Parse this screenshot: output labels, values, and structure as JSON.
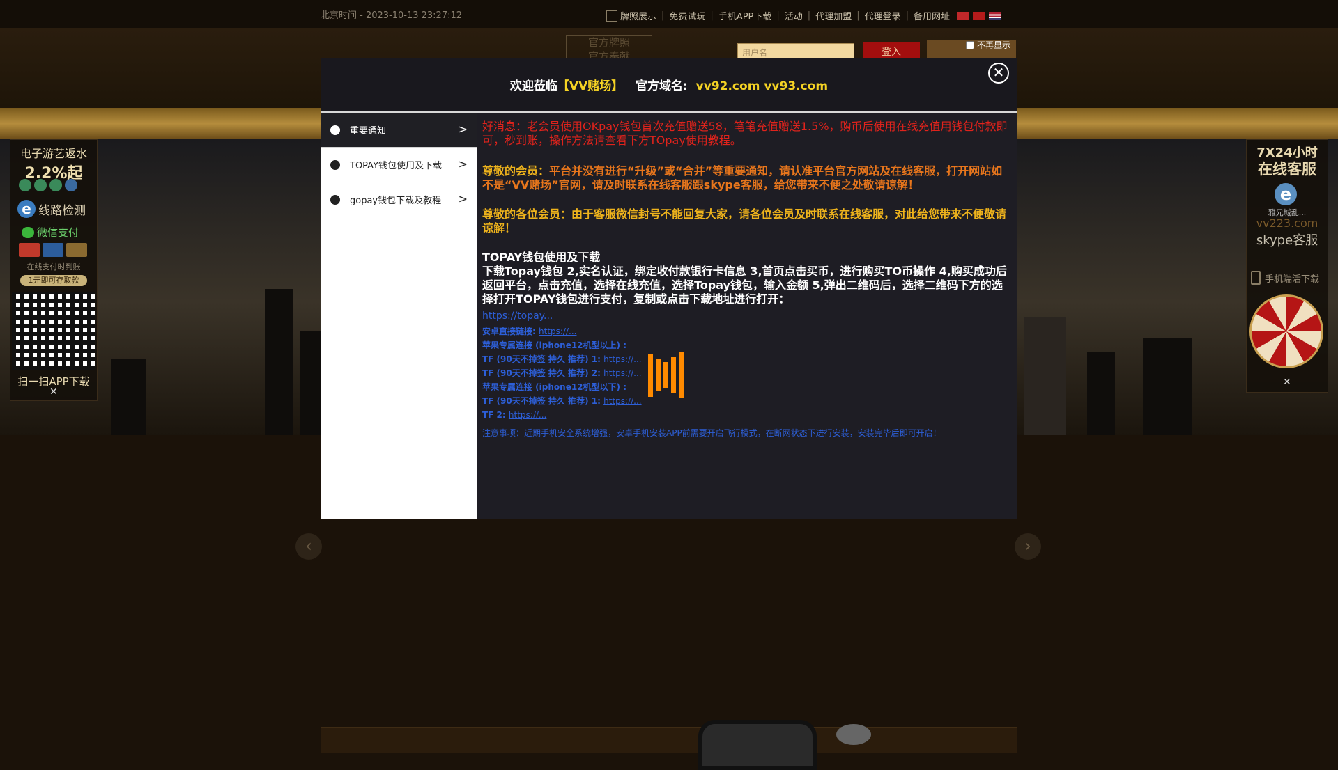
{
  "topbar": {
    "clock": "北京时间 - 2023-10-13 23:27:12",
    "nav": [
      "牌照展示",
      "免费试玩",
      "手机APP下载",
      "活动",
      "代理加盟",
      "代理登录",
      "备用网址"
    ]
  },
  "header": {
    "seal_line1": "官方牌照",
    "seal_line2": "官方奉献",
    "username_placeholder": "用户名",
    "login_label": "登入",
    "no_show_label": "不再显示"
  },
  "left_panel": {
    "title": "电子游艺返水",
    "rate": "2.2%起",
    "line_check": "线路检测",
    "wechat": "微信支付",
    "note": "在线支付时到账",
    "badge": "1元即可存取款",
    "qr_caption": "扫一扫APP下载",
    "close": "✕"
  },
  "right_panel": {
    "hours": "7X24小时",
    "online": "在线客服",
    "small": "雅兄城乱...",
    "domain": "vv223.com",
    "skype": "skype客服",
    "mobile": "手机端活下载",
    "close": "✕"
  },
  "modal": {
    "welcome_prefix": "欢迎莅临",
    "brand": "【VV赌场】",
    "domain_label": "官方域名:",
    "domains": "vv92.com vv93.com",
    "close": "✕",
    "menu": [
      {
        "label": "重要通知",
        "active": true
      },
      {
        "label": "TOPAY钱包使用及下载",
        "active": false
      },
      {
        "label": "gopay钱包下载及教程",
        "active": false
      }
    ],
    "notice_red": "好消息：老会员使用OKpay钱包首次充值赠送58，笔笔充值赠送1.5%，购币后使用在线充值用钱包付款即可，秒到账，操作方法请查看下方TOpay使用教程。",
    "notice1_lead": "尊敬的会员：",
    "notice1_body": "平台并没有进行“升级”或“合并”等重要通知，请认准平台官方网站及在线客服，打开网站如不是“VV赌场”官网，请及时联系在线客服跟skype客服，给您带来不便之处敬请谅解！",
    "notice2_lead": "尊敬的各位会员：",
    "notice2_body": "由于客服微信封号不能回复大家，请各位会员及时联系在线客服，对此给您带来不便敬请谅解！",
    "topay_title": "TOPAY钱包使用及下载",
    "topay_body": "下载Topay钱包 2,实名认证，绑定收付款银行卡信息 3,首页点击买币，进行购买TO币操作 4,购买成功后返回平台，点击充值，选择在线充值，选择Topay钱包，输入金额 5,弹出二维码后，选择二维码下方的选择打开TOPAY钱包进行支付，复制或点击下载地址进行打开：",
    "link1": "https://topay...",
    "link_lines": [
      {
        "label": "安卓直接链接:",
        "url": "https://..."
      },
      {
        "label": "苹果专属连接 (iphone12机型以上) :",
        "url": ""
      },
      {
        "label": "TF (90天不掉签 持久 推荐) 1:",
        "url": "https://..."
      },
      {
        "label": "TF (90天不掉签 持久 推荐) 2:",
        "url": "https://..."
      },
      {
        "label": "苹果专属连接 (iphone12机型以下) :",
        "url": ""
      },
      {
        "label": "TF (90天不掉签 持久 推荐) 1:",
        "url": "https://..."
      },
      {
        "label": "TF 2:",
        "url": "https://..."
      }
    ],
    "warning": "注意事项：近期手机安全系统增强，安卓手机安装APP前需要开启飞行模式，在断网状态下进行安装，安装完毕后即可开启！"
  },
  "arrows": {
    "prev": "‹",
    "next": "›"
  }
}
